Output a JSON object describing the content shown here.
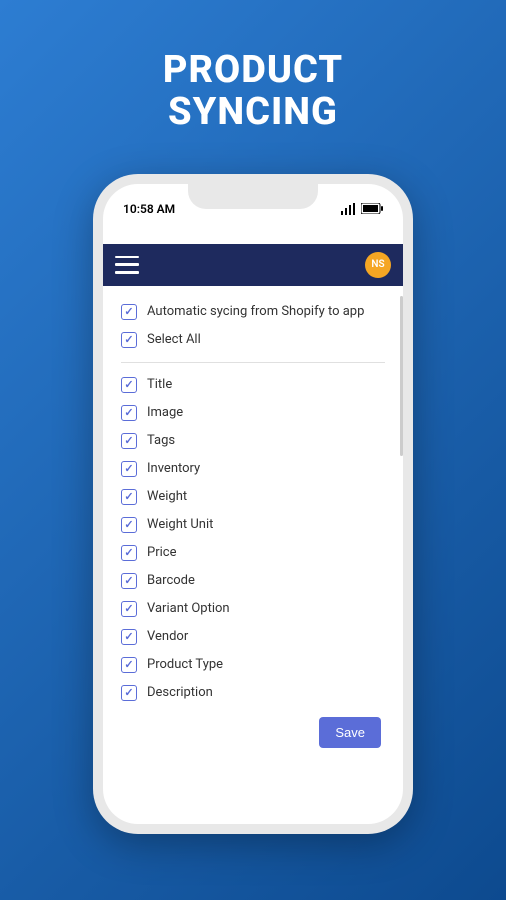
{
  "hero": {
    "line1": "PRODUCT",
    "line2": "SYNCING"
  },
  "statusBar": {
    "time": "10:58 AM"
  },
  "header": {
    "avatarInitials": "NS"
  },
  "topOptions": [
    {
      "label": "Automatic sycing from Shopify to app",
      "checked": true
    },
    {
      "label": "Select All",
      "checked": true
    }
  ],
  "syncFields": [
    {
      "label": "Title",
      "checked": true
    },
    {
      "label": "Image",
      "checked": true
    },
    {
      "label": "Tags",
      "checked": true
    },
    {
      "label": "Inventory",
      "checked": true
    },
    {
      "label": "Weight",
      "checked": true
    },
    {
      "label": "Weight Unit",
      "checked": true
    },
    {
      "label": "Price",
      "checked": true
    },
    {
      "label": "Barcode",
      "checked": true
    },
    {
      "label": "Variant Option",
      "checked": true
    },
    {
      "label": "Vendor",
      "checked": true
    },
    {
      "label": "Product Type",
      "checked": true
    },
    {
      "label": "Description",
      "checked": true
    }
  ],
  "actions": {
    "saveLabel": "Save"
  }
}
